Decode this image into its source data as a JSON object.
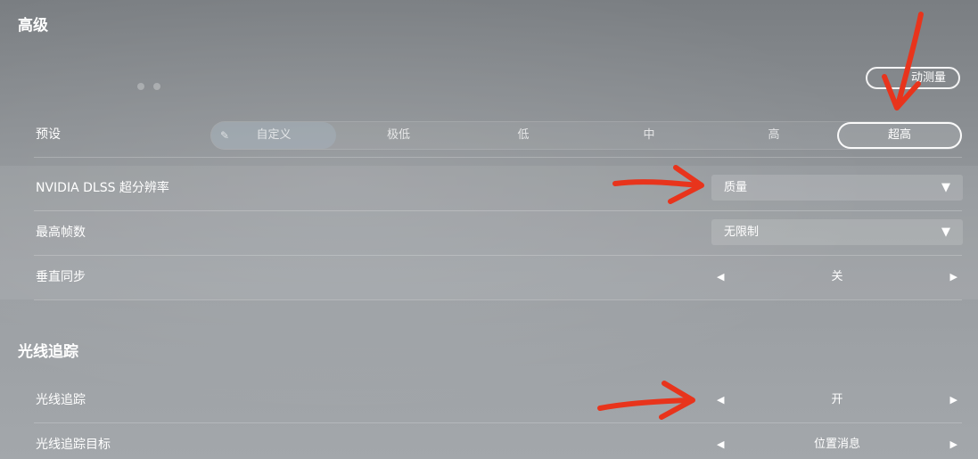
{
  "sections": {
    "advanced_title": "高级",
    "raytracing_title": "光线追踪"
  },
  "auto_measure_label": "动测量",
  "preset": {
    "label": "预设",
    "options": [
      "自定义",
      "极低",
      "低",
      "中",
      "高",
      "超高"
    ],
    "selected": "超高",
    "icon": "pencil-icon"
  },
  "dlss": {
    "label": "NVIDIA DLSS 超分辨率",
    "value": "质量"
  },
  "max_fps": {
    "label": "最高帧数",
    "value": "无限制"
  },
  "vsync": {
    "label": "垂直同步",
    "value": "关"
  },
  "raytracing": {
    "label": "光线追踪",
    "value": "开"
  },
  "raytracing_target": {
    "label": "光线追踪目标",
    "value": "位置消息"
  },
  "glyphs": {
    "caret": "▼",
    "prev": "◀",
    "next": "▶",
    "pencil": "✎"
  },
  "colors": {
    "annotation_arrow": "#e8341c"
  }
}
